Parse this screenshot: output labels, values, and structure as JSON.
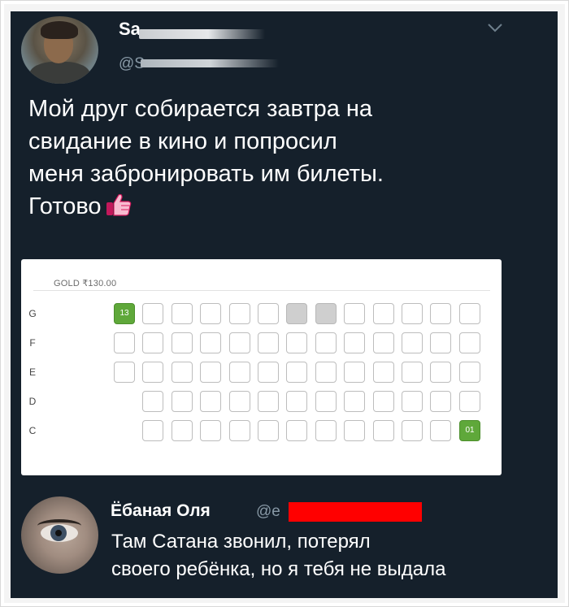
{
  "tweet1": {
    "username": "Sa",
    "handle": "@S",
    "text_lines": [
      "Мой друг собирается завтра на",
      "свидание в кино и попросил",
      "меня забронировать им билеты.",
      "Готово"
    ],
    "menu_icon": "chevron-down-icon",
    "emoji_icon": "thumbs-up-icon"
  },
  "seatmap": {
    "section_label": "GOLD ₹130.00",
    "rows": [
      {
        "label": "G",
        "seats": [
          "selected",
          "empty",
          "empty",
          "empty",
          "empty",
          "empty",
          "taken",
          "taken",
          "empty",
          "empty",
          "empty",
          "empty",
          "empty"
        ],
        "numbers": {
          "0": "13"
        }
      },
      {
        "label": "F",
        "seats": [
          "empty",
          "empty",
          "empty",
          "empty",
          "empty",
          "empty",
          "empty",
          "empty",
          "empty",
          "empty",
          "empty",
          "empty",
          "empty"
        ],
        "numbers": {}
      },
      {
        "label": "E",
        "seats": [
          "empty",
          "empty",
          "empty",
          "empty",
          "empty",
          "empty",
          "empty",
          "empty",
          "empty",
          "empty",
          "empty",
          "empty",
          "empty"
        ],
        "numbers": {}
      },
      {
        "label": "D",
        "seats": [
          "gap",
          "empty",
          "empty",
          "empty",
          "empty",
          "empty",
          "empty",
          "empty",
          "empty",
          "empty",
          "empty",
          "empty",
          "empty"
        ],
        "numbers": {}
      },
      {
        "label": "C",
        "seats": [
          "gap",
          "empty",
          "empty",
          "empty",
          "empty",
          "empty",
          "empty",
          "empty",
          "empty",
          "empty",
          "empty",
          "empty",
          "selected"
        ],
        "numbers": {
          "12": "01"
        }
      }
    ],
    "colors": {
      "selected": "#5fa83a",
      "taken": "#cfcfcf",
      "empty": "#ffffff"
    }
  },
  "tweet2": {
    "username": "Ёбаная Оля",
    "handle": "@е",
    "text_lines": [
      "Там Сатана звонил, потерял",
      "своего ребёнка, но я тебя не  выдала"
    ],
    "redaction_color": "#ff0000"
  },
  "theme": {
    "background": "#15202b",
    "text": "#ffffff",
    "muted": "#8899a6"
  }
}
